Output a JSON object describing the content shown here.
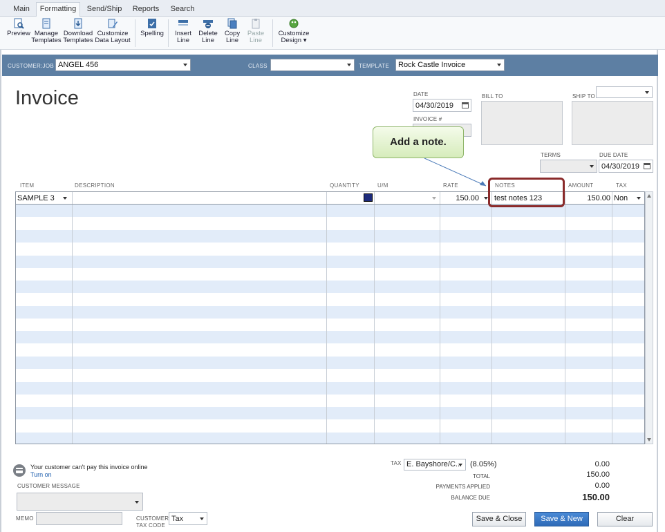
{
  "ribbon": {
    "tabs": [
      "Main",
      "Formatting",
      "Send/Ship",
      "Reports",
      "Search"
    ],
    "active_tab": "Formatting",
    "buttons": {
      "preview": "Preview",
      "manage_templates_1": "Manage",
      "manage_templates_2": "Templates",
      "download_templates_1": "Download",
      "download_templates_2": "Templates",
      "customize_layout_1": "Customize",
      "customize_layout_2": "Data Layout",
      "spelling": "Spelling",
      "insert_line_1": "Insert",
      "insert_line_2": "Line",
      "delete_line_1": "Delete",
      "delete_line_2": "Line",
      "copy_line_1": "Copy",
      "copy_line_2": "Line",
      "paste_line_1": "Paste",
      "paste_line_2": "Line",
      "customize_design_1": "Customize",
      "customize_design_2": "Design ▾"
    }
  },
  "header": {
    "customer_label": "CUSTOMER:JOB",
    "customer_value": "ANGEL 456",
    "class_label": "CLASS",
    "class_value": "",
    "template_label": "TEMPLATE",
    "template_value": "Rock Castle Invoice"
  },
  "form": {
    "title": "Invoice",
    "date_label": "DATE",
    "date_value": "04/30/2019",
    "invoice_no_label": "INVOICE #",
    "invoice_no_value": "",
    "bill_to_label": "BILL TO",
    "ship_to_label": "SHIP TO",
    "terms_label": "TERMS",
    "terms_value": "",
    "due_date_label": "DUE DATE",
    "due_date_value": "04/30/2019"
  },
  "callout": {
    "text": "Add a note."
  },
  "table": {
    "columns": [
      "ITEM",
      "DESCRIPTION",
      "QUANTITY",
      "U/M",
      "RATE",
      "NOTES",
      "AMOUNT",
      "TAX"
    ],
    "rows": [
      {
        "item": "SAMPLE 3",
        "description": "",
        "quantity": "",
        "um": "",
        "rate": "150.00",
        "notes": "test notes 123",
        "amount": "150.00",
        "tax": "Non"
      }
    ]
  },
  "footer": {
    "online_msg": "Your customer can't pay this invoice online",
    "turn_on": "Turn on",
    "customer_message_label": "CUSTOMER MESSAGE",
    "memo_label": "MEMO",
    "customer_tax_code_label_1": "CUSTOMER",
    "customer_tax_code_label_2": "TAX CODE",
    "tax_code_value": "Tax",
    "tax_label": "TAX",
    "tax_item": "E. Bayshore/C...",
    "tax_rate": "(8.05%)",
    "tax_amount": "0.00",
    "total_label": "TOTAL",
    "total_value": "150.00",
    "payments_label": "PAYMENTS APPLIED",
    "payments_value": "0.00",
    "balance_label": "BALANCE DUE",
    "balance_value": "150.00",
    "save_close": "Save & Close",
    "save_new": "Save & New",
    "clear": "Clear"
  }
}
